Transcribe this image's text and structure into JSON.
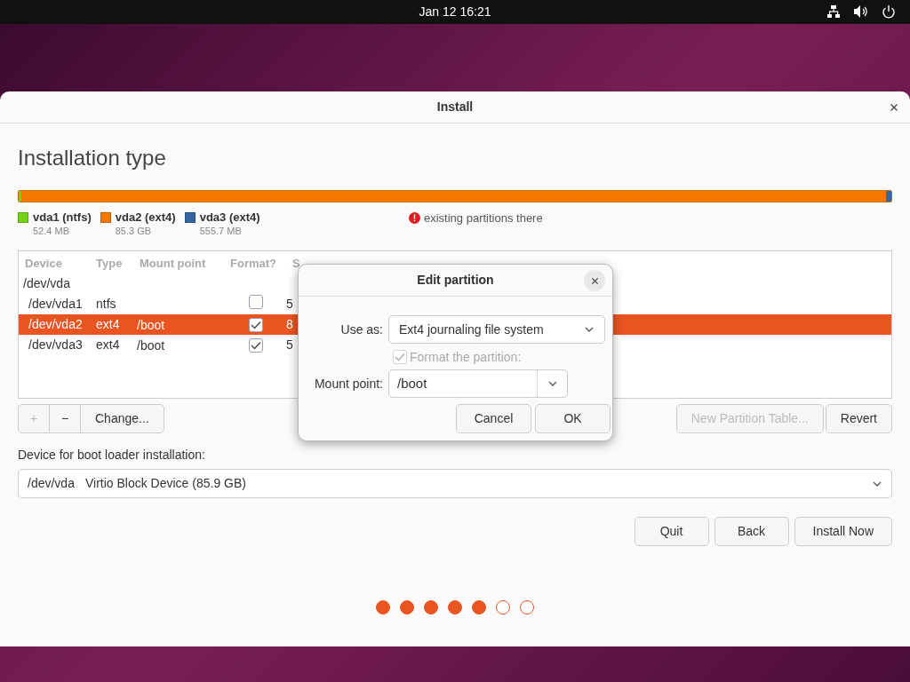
{
  "top_bar": {
    "clock": "Jan 12  16:21"
  },
  "window": {
    "title": "Install",
    "heading": "Installation type"
  },
  "partition_bar": {
    "warning": "existing partitions there",
    "segments": [
      {
        "color": "#73d216",
        "level": 0.001
      },
      {
        "color": "#f57900",
        "level": 0.993
      },
      {
        "color": "#3465a4",
        "level": 0.006
      }
    ]
  },
  "legend": [
    {
      "name": "vda1 (ntfs)",
      "size": "52.4 MB",
      "color": "#73d216"
    },
    {
      "name": "vda2 (ext4)",
      "size": "85.3 GB",
      "color": "#f57900"
    },
    {
      "name": "vda3 (ext4)",
      "size": "555.7 MB",
      "color": "#3465a4"
    }
  ],
  "table": {
    "columns": [
      "Device",
      "Type",
      "Mount point",
      "Format?",
      "S"
    ],
    "rows": [
      {
        "device": "/dev/vda",
        "kind": "disk",
        "selected": false
      },
      {
        "device": "/dev/vda1",
        "type": "ntfs",
        "mount": "",
        "format": false,
        "size": "5",
        "kind": "partition",
        "selected": false
      },
      {
        "device": "/dev/vda2",
        "type": "ext4",
        "mount": "/boot",
        "format": true,
        "size": "8",
        "kind": "partition",
        "selected": true
      },
      {
        "device": "/dev/vda3",
        "type": "ext4",
        "mount": "/boot",
        "format": true,
        "size": "5",
        "kind": "partition",
        "selected": false
      }
    ]
  },
  "table_buttons": [
    {
      "label": "+",
      "disabled": true
    },
    {
      "label": "−",
      "disabled": false
    },
    {
      "label": "Change...",
      "disabled": false
    }
  ],
  "table_buttons_right": [
    {
      "label": "New Partition Table...",
      "disabled": true
    },
    {
      "label": "Revert",
      "disabled": false
    }
  ],
  "boot_loader": {
    "label": "Device for boot loader installation:",
    "device": "/dev/vda",
    "description": "Virtio Block Device (85.9 GB)"
  },
  "buttons": [
    "Quit",
    "Back",
    "Install Now"
  ],
  "progress_dots": [
    {
      "filled": true
    },
    {
      "filled": true
    },
    {
      "filled": true
    },
    {
      "filled": true
    },
    {
      "filled": true
    },
    {
      "filled": false
    },
    {
      "filled": false
    }
  ],
  "dialog": {
    "title": "Edit partition",
    "use_as_label": "Use as:",
    "use_as": "Ext4 journaling file system",
    "format_label": "Format the partition:",
    "format_checked": true,
    "format_disabled": true,
    "mount_label": "Mount point:",
    "mount": "/boot",
    "buttons": [
      "Cancel",
      "OK"
    ]
  }
}
